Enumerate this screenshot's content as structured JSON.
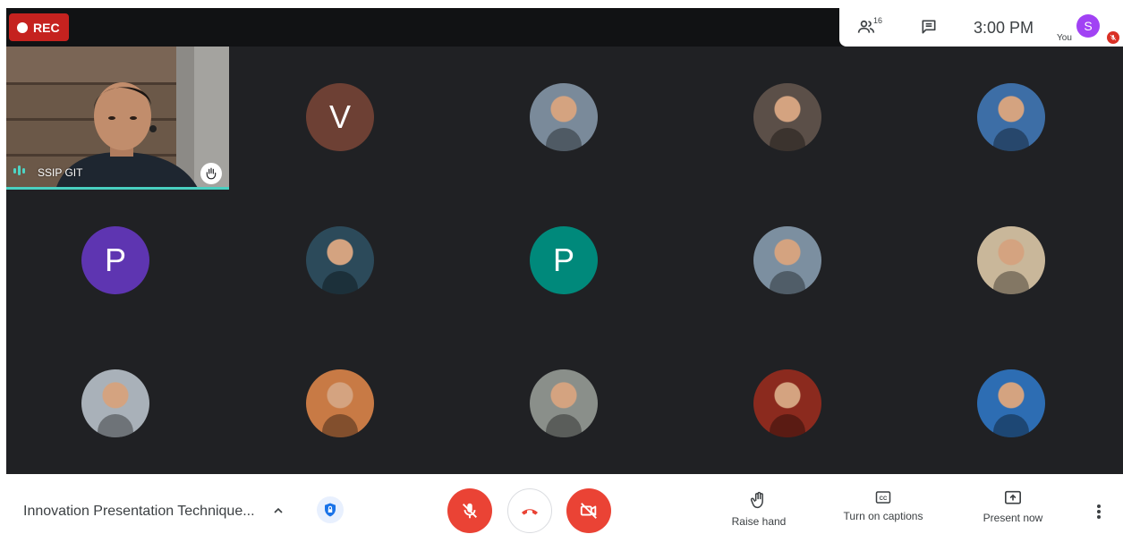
{
  "recording": {
    "label": "REC",
    "color": "#c5221f"
  },
  "header": {
    "participants_icon": "people-icon",
    "participants_count": "16",
    "chat_icon": "chat-icon",
    "time": "3:00 PM",
    "self_label": "You",
    "self_initial": "S",
    "self_avatar_color": "#a142f4",
    "self_muted_icon": "mic-off-icon"
  },
  "video_tile": {
    "name": "SSIP GIT",
    "raised_hand_icon": "hand-icon",
    "speaking_color": "#49d0c1"
  },
  "participants": [
    {
      "initial": "V",
      "color": "#6d4034",
      "kind": "letter"
    },
    {
      "initial": "",
      "color": "#7a8a9a",
      "kind": "photo"
    },
    {
      "initial": "",
      "color": "#5b4f48",
      "kind": "photo"
    },
    {
      "initial": "",
      "color": "#3d6ea6",
      "kind": "photo"
    },
    {
      "initial": "P",
      "color": "#5e35b1",
      "kind": "letter"
    },
    {
      "initial": "",
      "color": "#2c4a5a",
      "kind": "photo"
    },
    {
      "initial": "P",
      "color": "#00897b",
      "kind": "letter"
    },
    {
      "initial": "",
      "color": "#7c8fa0",
      "kind": "photo"
    },
    {
      "initial": "",
      "color": "#c9b79a",
      "kind": "photo"
    },
    {
      "initial": "",
      "color": "#a9b1b9",
      "kind": "photo"
    },
    {
      "initial": "",
      "color": "#c87a45",
      "kind": "photo"
    },
    {
      "initial": "",
      "color": "#8a8f8a",
      "kind": "photo"
    },
    {
      "initial": "",
      "color": "#8b2a1e",
      "kind": "photo"
    },
    {
      "initial": "",
      "color": "#2d6db3",
      "kind": "photo"
    }
  ],
  "footer": {
    "meeting_title": "Innovation Presentation Technique...",
    "mic_icon": "mic-off-icon",
    "hangup_icon": "hangup-icon",
    "camera_icon": "camera-off-icon",
    "raise_hand": "Raise hand",
    "captions": "Turn on captions",
    "present": "Present now",
    "more_icon": "more-vert-icon"
  }
}
